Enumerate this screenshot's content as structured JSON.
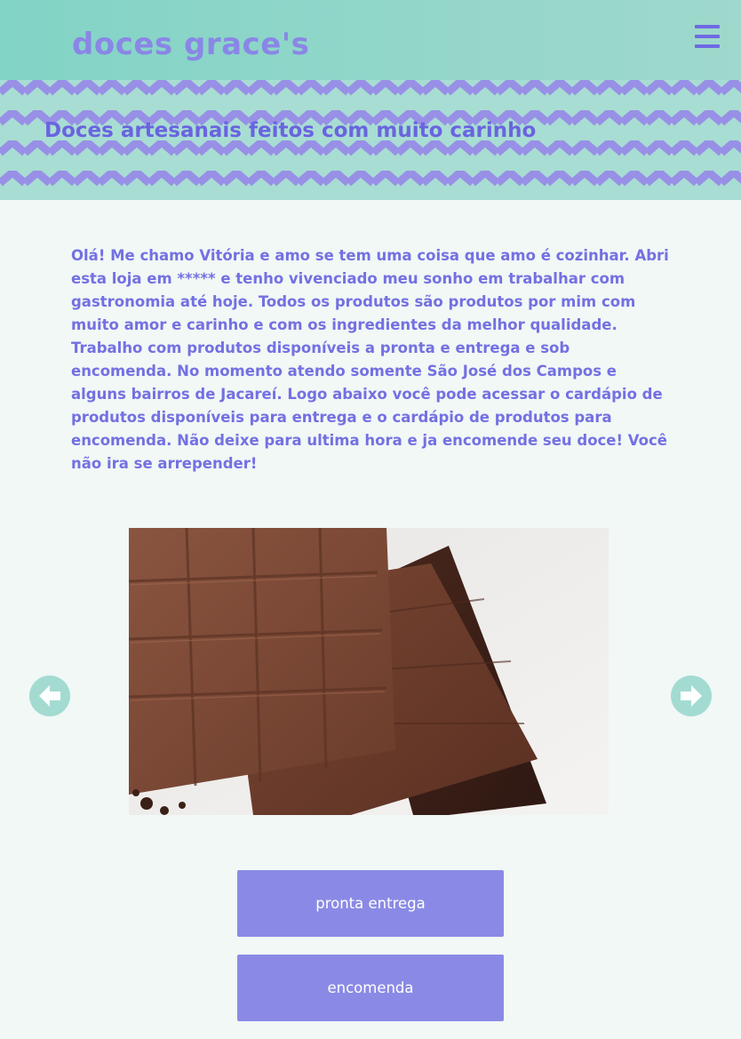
{
  "header": {
    "logo": "doces grace's",
    "menu_icon": "hamburger-menu-icon"
  },
  "banner": {
    "title": "Doces artesanais feitos com muito carinho"
  },
  "intro": {
    "text": "Olá! Me chamo Vitória e amo se tem uma coisa que amo é cozinhar. Abri esta loja em ***** e tenho vivenciado meu sonho em trabalhar com gastronomia até hoje. Todos os produtos são produtos por mim com muito amor e carinho e com os ingredientes da melhor qualidade. Trabalho com produtos disponíveis a pronta e entrega e sob encomenda. No momento atendo somente São José dos Campos e alguns bairros de Jacareí. Logo abaixo você pode acessar o cardápio de produtos disponíveis para entrega e o cardápio de produtos para encomenda. Não deixe para ultima hora e ja encomende seu doce! Você não ira se arrepender!"
  },
  "carousel": {
    "prev_icon": "arrow-left-icon",
    "next_icon": "arrow-right-icon"
  },
  "buttons": {
    "pronta_entrega": "pronta entrega",
    "encomenda": "encomenda"
  },
  "colors": {
    "header_bg": "#82d4c6",
    "accent": "#8a86e6",
    "text": "#7470e2",
    "button_bg": "#8a8ae6",
    "arrow_bg": "#a3dbd1",
    "page_bg": "#f1f8f6"
  }
}
